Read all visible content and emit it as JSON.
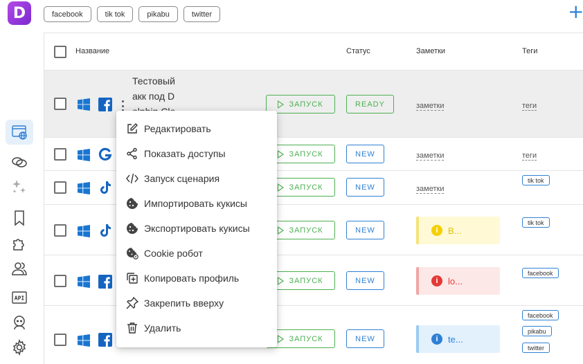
{
  "app": {
    "logo_letter": "D"
  },
  "sidebar": {
    "items": [
      {
        "name": "browser-profiles",
        "active": true
      },
      {
        "name": "proxies"
      },
      {
        "name": "automation"
      },
      {
        "name": "bookmarks"
      },
      {
        "name": "extensions"
      },
      {
        "name": "team"
      },
      {
        "name": "api",
        "label": "API"
      },
      {
        "name": "support"
      },
      {
        "name": "settings"
      }
    ]
  },
  "filters": [
    "facebook",
    "tik tok",
    "pikabu",
    "twitter"
  ],
  "table": {
    "headers": {
      "name": "Название",
      "status": "Статус",
      "notes": "Заметки",
      "tags": "Теги"
    },
    "launch_label": "ЗАПУСК",
    "rows": [
      {
        "os": "windows",
        "network": "facebook",
        "name": "Тестовый акк под D olphin Clo",
        "status": "READY",
        "note_link": "заметки",
        "tag_link": "теги"
      },
      {
        "os": "windows",
        "network": "google",
        "status": "NEW",
        "note_link": "заметки",
        "tag_link": "теги"
      },
      {
        "os": "windows",
        "network": "tiktok",
        "status": "NEW",
        "note_link": "заметки",
        "tags": [
          "tik tok"
        ]
      },
      {
        "os": "windows",
        "network": "tiktok",
        "status": "NEW",
        "note": {
          "color": "yellow",
          "text": "B..."
        },
        "tags": [
          "tik tok"
        ]
      },
      {
        "os": "windows",
        "network": "facebook",
        "status": "NEW",
        "note": {
          "color": "red",
          "text": "lo..."
        },
        "tags": [
          "facebook"
        ]
      },
      {
        "os": "windows",
        "network": "facebook",
        "status": "NEW",
        "note": {
          "color": "blue",
          "text": "te..."
        },
        "tags": [
          "facebook",
          "pikabu",
          "twitter"
        ]
      }
    ]
  },
  "context_menu": {
    "items": [
      {
        "icon": "edit-icon",
        "label": "Редактировать"
      },
      {
        "icon": "share-icon",
        "label": "Показать доступы"
      },
      {
        "icon": "code-icon",
        "label": "Запуск сценария"
      },
      {
        "icon": "cookie-icon",
        "label": "Импортировать кукисы"
      },
      {
        "icon": "cookie-icon",
        "label": "Экспортировать кукисы"
      },
      {
        "icon": "cookie-robot-icon",
        "label": "Cookie робот"
      },
      {
        "icon": "copy-icon",
        "label": "Копировать профиль"
      },
      {
        "icon": "pin-icon",
        "label": "Закрепить вверху"
      },
      {
        "icon": "trash-icon",
        "label": "Удалить"
      }
    ]
  },
  "colors": {
    "accent": "#2f80d5",
    "success": "#4caf50",
    "logo": "#9b3ae0"
  }
}
